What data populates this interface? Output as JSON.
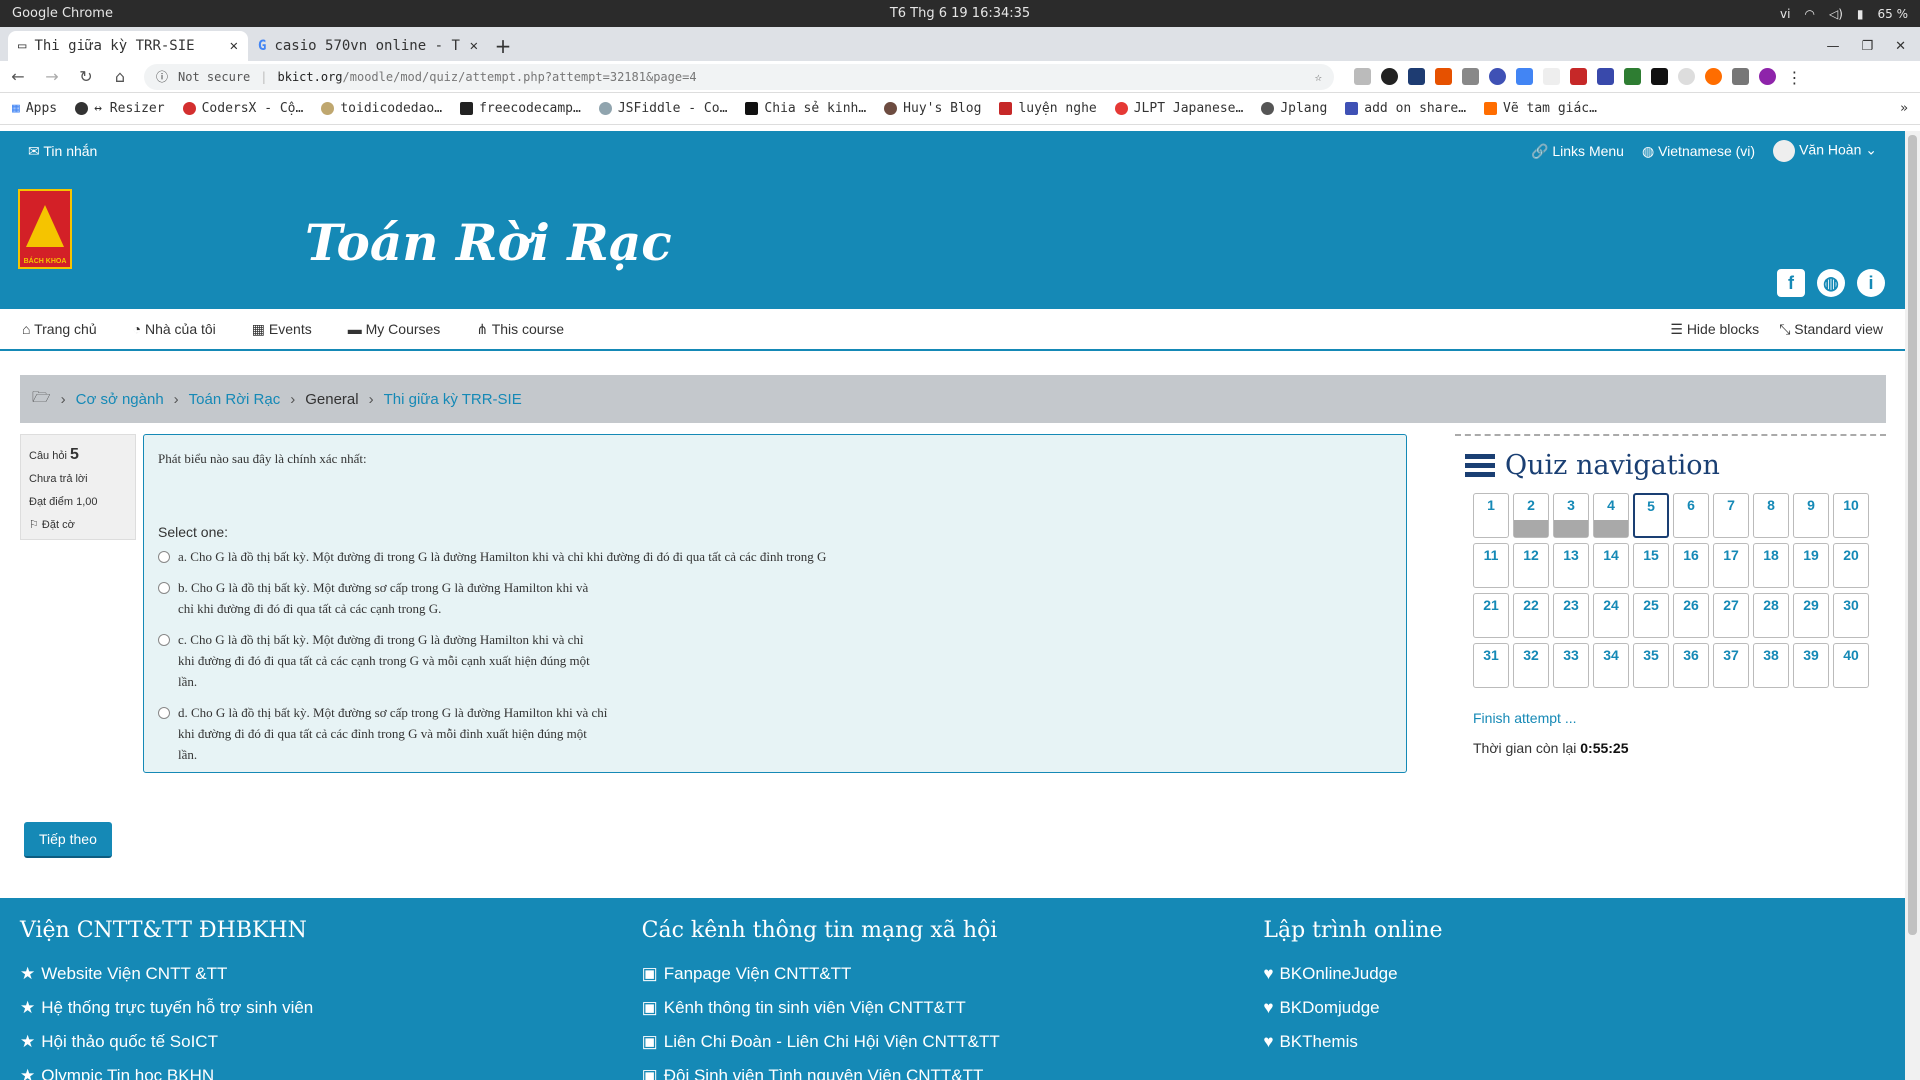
{
  "os": {
    "app": "Google Chrome",
    "clock": "T6 Thg 6 19  16:34:35",
    "lang": "vi",
    "battery": "65 %"
  },
  "tabs": [
    {
      "title": "Thi giữa kỳ TRR-SIE"
    },
    {
      "title": "casio 570vn online - T"
    }
  ],
  "omnibox": {
    "security": "Not secure",
    "host": "bkict.org",
    "path": "/moodle/mod/quiz/attempt.php?attempt=32181&page=4"
  },
  "bookmarks": [
    "Apps",
    "↔ Resizer",
    "CodersX - Cộ…",
    "toidicodedao…",
    "freecodecamp…",
    "JSFiddle - Co…",
    "Chia sẻ kinh…",
    "Huy's Blog",
    "luyện nghe",
    "JLPT Japanese…",
    "Jplang",
    "add on share…",
    "Vẽ tam giác…"
  ],
  "site": {
    "msg": "Tin nhắn",
    "links_menu": "Links Menu",
    "language": "Vietnamese (vi)",
    "user": "Văn Hoàn",
    "title": "Toán Rời Rạc",
    "logo_caption": "BÁCH KHOA",
    "menu": [
      "Trang chủ",
      "Nhà của tôi",
      "Events",
      "My Courses",
      "This course"
    ],
    "hide_blocks": "Hide blocks",
    "standard_view": "Standard view"
  },
  "breadcrumb": [
    "Cơ sở ngành",
    "Toán Rời Rạc",
    "General",
    "Thi giữa kỳ TRR-SIE"
  ],
  "question": {
    "label": "Câu hỏi",
    "number": "5",
    "status": "Chưa trả lời",
    "points": "Đạt điểm 1,00",
    "flag": "Đặt cờ",
    "prompt": "Phát biểu nào sau đây là chính xác nhất:",
    "select": "Select one:",
    "options": [
      "a. Cho G là đồ thị bất kỳ. Một đường đi trong G là đường Hamilton khi và chỉ khi đường đi đó đi qua tất cả các đỉnh trong G",
      "b. Cho G là đồ thị bất kỳ. Một đường sơ cấp trong G là đường Hamilton khi và\nchỉ khi đường đi đó đi qua tất cả các cạnh trong G.",
      "c. Cho G là đồ thị bất kỳ. Một đường đi trong G là đường Hamilton khi và chỉ\nkhi đường đi đó đi qua tất cả các cạnh trong G và mỗi cạnh xuất hiện đúng một\nlần.",
      "d. Cho G là đồ thị bất kỳ. Một đường sơ cấp trong G là đường Hamilton khi và chỉ\nkhi đường đi đó đi qua tất cả các đỉnh trong G và mỗi đỉnh xuất hiện đúng một\nlần."
    ]
  },
  "next_button": "Tiếp theo",
  "quiz_nav": {
    "title": "Quiz navigation",
    "answered": [
      2,
      3,
      4
    ],
    "current": 5,
    "finish": "Finish attempt ...",
    "time_label": "Thời gian còn lại",
    "time_left": "0:55:25"
  },
  "footer": {
    "col1": {
      "title": "Viện CNTT&TT ĐHBKHN",
      "items": [
        "Website Viện CNTT &TT",
        "Hệ thống trực tuyến hỗ trợ sinh viên",
        "Hội thảo quốc tế SoICT",
        "Olympic Tin học BKHN"
      ]
    },
    "col2": {
      "title": "Các kênh thông tin mạng xã hội",
      "items": [
        "Fanpage Viện CNTT&TT",
        "Kênh thông tin sinh viên Viện CNTT&TT",
        "Liên Chi Đoàn - Liên Chi Hội Viện CNTT&TT",
        "Đội Sinh viên Tình nguyện Viện CNTT&TT"
      ]
    },
    "col3": {
      "title": "Lập trình online",
      "items": [
        "BKOnlineJudge",
        "BKDomjudge",
        "BKThemis"
      ]
    }
  }
}
